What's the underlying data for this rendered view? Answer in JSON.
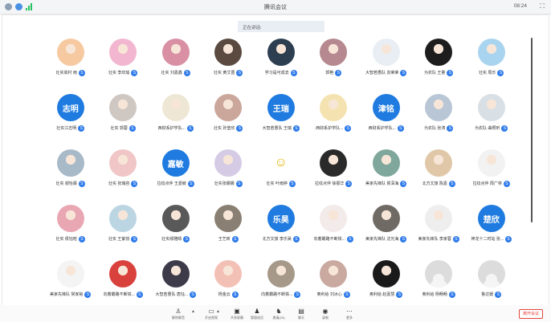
{
  "window": {
    "title": "腾讯会议",
    "time": "08:24"
  },
  "speaking": {
    "label": "正在讲话:"
  },
  "participants": [
    [
      {
        "name": "壮实高村 雨",
        "avatar": "photo",
        "color": "#f6c9a0"
      },
      {
        "name": "壮实 李欣瑜",
        "avatar": "photo",
        "color": "#f2b6d0"
      },
      {
        "name": "壮实 刘嘉鑫",
        "avatar": "photo",
        "color": "#d98fa4"
      },
      {
        "name": "壮实 黄艾晋",
        "avatar": "photo",
        "color": "#5a4a3f"
      },
      {
        "name": "学习是可成去",
        "avatar": "photo",
        "color": "#2c3e50"
      },
      {
        "name": "郭艳",
        "avatar": "photo",
        "color": "#b5898f"
      },
      {
        "name": "大智若愚队 袁荣荣",
        "avatar": "photo",
        "color": "#e8eef4"
      },
      {
        "name": "为农队 王量",
        "avatar": "photo",
        "color": "#1d1d1d"
      },
      {
        "name": "壮实 周乐",
        "avatar": "photo",
        "color": "#a9d4ef"
      }
    ],
    [
      {
        "name": "壮实江志明",
        "avatar": "text",
        "text": "志明"
      },
      {
        "name": "壮实 郭蓉",
        "avatar": "photo",
        "color": "#cfc7c2"
      },
      {
        "name": "西财系护学队...",
        "avatar": "photo",
        "color": "#efe7d6"
      },
      {
        "name": "壮实 孙莹欣",
        "avatar": "photo",
        "color": "#caa69b"
      },
      {
        "name": "大智若愚队 王瑞",
        "avatar": "text",
        "text": "王瑞"
      },
      {
        "name": "西财系护学队...",
        "avatar": "photo",
        "color": "#f4e3b0"
      },
      {
        "name": "西财系护学队...",
        "avatar": "text",
        "text": "津铭"
      },
      {
        "name": "为农队 张涛",
        "avatar": "photo",
        "color": "#b8c6d6"
      },
      {
        "name": "为农队 曲照昕",
        "avatar": "photo",
        "color": "#d8dfe5"
      }
    ],
    [
      {
        "name": "壮实 谢怡霖",
        "avatar": "photo",
        "color": "#a8b9c8"
      },
      {
        "name": "壮实 张瑞容",
        "avatar": "photo",
        "color": "#f0c6c6"
      },
      {
        "name": "拉纹点伴 王嘉敏",
        "avatar": "text",
        "text": "嘉敏"
      },
      {
        "name": "壮实张娜娜",
        "avatar": "photo",
        "color": "#d5cbe5"
      },
      {
        "name": "壮实 叶雨婷",
        "avatar": "emoji",
        "text": "☺"
      },
      {
        "name": "拉纹点伴 徐振华",
        "avatar": "photo",
        "color": "#2a2a2a"
      },
      {
        "name": "美家先锋队 侯深海",
        "avatar": "photo",
        "color": "#7fa79b"
      },
      {
        "name": "北方文旅 陈嘉",
        "avatar": "photo",
        "color": "#e0c7a8"
      },
      {
        "name": "拉纹点伴 周广林",
        "avatar": "photo",
        "color": "#f2f2f2"
      }
    ],
    [
      {
        "name": "壮实 侯钰晗",
        "avatar": "photo",
        "color": "#e9a7b4"
      },
      {
        "name": "壮实 王紫悦",
        "avatar": "photo",
        "color": "#bcd5e3"
      },
      {
        "name": "壮实缪雅晴",
        "avatar": "photo",
        "color": "#595959"
      },
      {
        "name": "王艺昕",
        "avatar": "photo",
        "color": "#8a7f73"
      },
      {
        "name": "北方文旅 李乐昊",
        "avatar": "text",
        "text": "乐昊"
      },
      {
        "name": "向着霸路不断铁...",
        "avatar": "photo",
        "color": "#f3eaea"
      },
      {
        "name": "美家先锋队 沈光海",
        "avatar": "photo",
        "color": "#6f6a64"
      },
      {
        "name": "美家先锋队 李家蓉",
        "avatar": "photo",
        "color": "#eeeeee"
      },
      {
        "name": "神龙十二时站 张...",
        "avatar": "text",
        "text": "楚欣"
      }
    ],
    [
      {
        "name": "美家先锋队 常家裕",
        "avatar": "photo",
        "color": "#f4f4f4"
      },
      {
        "name": "向着霸路不断铁...",
        "avatar": "photo",
        "color": "#d9413c"
      },
      {
        "name": "大智若愚队 唐钰...",
        "avatar": "photo",
        "color": "#3d3a4a"
      },
      {
        "name": "杨金云",
        "avatar": "photo",
        "color": "#f3c0b5"
      },
      {
        "name": "向着霸路不断铁...",
        "avatar": "photo",
        "color": "#a7998a"
      },
      {
        "name": "奥利给 刘冰心",
        "avatar": "photo",
        "color": "#c9a9a0"
      },
      {
        "name": "奥利给 赵嘉慧",
        "avatar": "photo",
        "color": "#1a1a1a"
      },
      {
        "name": "奥利给 杨畅畅",
        "avatar": "blank"
      },
      {
        "name": "鲁达媛",
        "avatar": "blank"
      }
    ]
  ],
  "badge": "S",
  "toolbar": {
    "items": [
      {
        "label": "解除静音",
        "icon": "microphone-icon",
        "glyph": "♙"
      },
      {
        "label": "开启视频",
        "icon": "camera-icon",
        "glyph": "▭"
      },
      {
        "label": "共享屏幕",
        "icon": "share-screen-icon",
        "glyph": "▣"
      },
      {
        "label": "管理成员",
        "icon": "members-icon",
        "glyph": "♟"
      },
      {
        "label": "邀请(25)",
        "icon": "invite-icon",
        "glyph": "♞"
      },
      {
        "label": "聊天",
        "icon": "chat-icon",
        "glyph": "▤"
      },
      {
        "label": "录制",
        "icon": "record-icon",
        "glyph": "◉"
      },
      {
        "label": "更多",
        "icon": "more-icon",
        "glyph": "⋯"
      }
    ],
    "end_label": "离开会议"
  }
}
